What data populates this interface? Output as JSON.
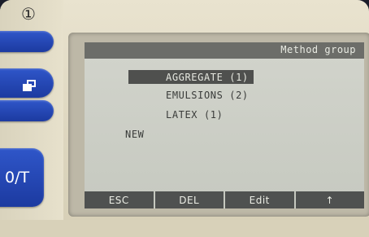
{
  "device": {
    "power_symbol": "①",
    "zero_tare_label": "0/T"
  },
  "screen": {
    "title": "Method group",
    "menu": [
      {
        "label": "AGGREGATE (1)",
        "selected": true
      },
      {
        "label": "EMULSIONS (2)",
        "selected": false
      },
      {
        "label": "LATEX (1)",
        "selected": false
      },
      {
        "label": "NEW",
        "selected": false
      }
    ],
    "softkeys": [
      "ESC",
      "DEL",
      "Edit",
      "↑"
    ]
  },
  "colors": {
    "hardware_button": "#2f56c9",
    "lcd_background": "#cfd1c9",
    "lcd_dark": "#4f504e"
  }
}
